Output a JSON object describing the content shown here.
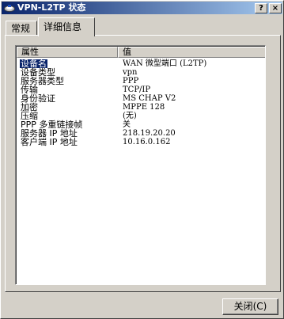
{
  "window": {
    "title": "VPN-L2TP 状态",
    "help_glyph": "?",
    "close_glyph": "×"
  },
  "tabs": [
    {
      "label": "常规",
      "active": false
    },
    {
      "label": "详细信息",
      "active": true
    }
  ],
  "table": {
    "columns": [
      "属性",
      "值"
    ],
    "rows": [
      {
        "name": "设备名",
        "value": "WAN 微型端口 (L2TP)",
        "selected": true
      },
      {
        "name": "设备类型",
        "value": "vpn"
      },
      {
        "name": "服务器类型",
        "value": "PPP"
      },
      {
        "name": "传输",
        "value": "TCP/IP"
      },
      {
        "name": "身份验证",
        "value": "MS CHAP V2"
      },
      {
        "name": "加密",
        "value": "MPPE 128"
      },
      {
        "name": "压缩",
        "value": "(无)"
      },
      {
        "name": "PPP 多重链接帧",
        "value": "关"
      },
      {
        "name": "服务器 IP 地址",
        "value": "218.19.20.20"
      },
      {
        "name": "客户端 IP 地址",
        "value": "10.16.0.162"
      }
    ]
  },
  "footer": {
    "close_label": "关闭(C)"
  },
  "colors": {
    "titlebar_start": "#0a246a",
    "titlebar_end": "#a6caf0",
    "selection": "#0a246a",
    "face": "#d4d0c8"
  }
}
